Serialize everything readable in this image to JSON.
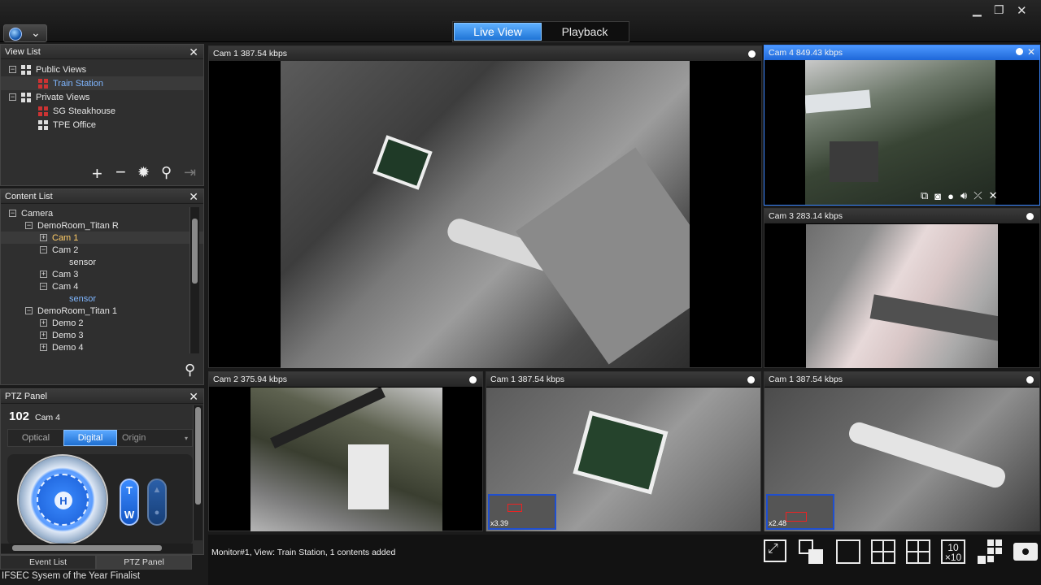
{
  "header": {
    "tabs": [
      {
        "label": "Live View",
        "active": true
      },
      {
        "label": "Playback",
        "active": false
      }
    ],
    "window_controls": [
      "minimize",
      "restore",
      "close"
    ]
  },
  "view_list": {
    "title": "View List",
    "items": [
      {
        "label": "Public Views",
        "level": 0
      },
      {
        "label": "Train Station",
        "level": 1,
        "highlighted": true
      },
      {
        "label": "Private Views",
        "level": 0
      },
      {
        "label": "SG Steakhouse",
        "level": 1
      },
      {
        "label": "TPE Office",
        "level": 1
      }
    ],
    "tools": [
      "add-icon",
      "remove-icon",
      "gear-icon",
      "search-icon",
      "export-icon"
    ]
  },
  "content_list": {
    "title": "Content List",
    "items": [
      {
        "label": "Camera",
        "level": 0
      },
      {
        "label": "DemoRoom_Titan R",
        "level": 1
      },
      {
        "label": "Cam 1",
        "level": 2,
        "highlighted": true
      },
      {
        "label": "Cam 2",
        "level": 2
      },
      {
        "label": "sensor",
        "level": 3
      },
      {
        "label": "Cam 3",
        "level": 2
      },
      {
        "label": "Cam 4",
        "level": 2
      },
      {
        "label": "sensor",
        "level": 3,
        "highlighted": true
      },
      {
        "label": "DemoRoom_Titan 1",
        "level": 1
      },
      {
        "label": "Demo 2",
        "level": 2
      },
      {
        "label": "Demo 3",
        "level": 2
      },
      {
        "label": "Demo 4",
        "level": 2
      }
    ]
  },
  "ptz": {
    "title": "PTZ Panel",
    "number": "102",
    "camera": "Cam 4",
    "modes": [
      "Optical",
      "Digital"
    ],
    "active_mode": "Digital",
    "origin_label": "Origin",
    "joystick_center": "H",
    "zoom_t": "T",
    "zoom_w": "W"
  },
  "bottom_tabs": [
    {
      "label": "Event List",
      "active": false
    },
    {
      "label": "PTZ Panel",
      "active": true
    }
  ],
  "footer_caption": "IFSEC Sysem of the Year Finalist",
  "cameras": [
    {
      "id": "main",
      "label": "Cam 1  387.54 kbps"
    },
    {
      "id": "top-right",
      "label": "Cam 4  849.43 kbps",
      "active": true
    },
    {
      "id": "mid-right",
      "label": "Cam 3  283.14 kbps"
    },
    {
      "id": "bottom-left",
      "label": "Cam 2  375.94 kbps"
    },
    {
      "id": "bottom-mid",
      "label": "Cam 1  387.54 kbps",
      "zoom": "x3.39"
    },
    {
      "id": "bottom-right",
      "label": "Cam 1  387.54 kbps",
      "zoom": "x2.48"
    }
  ],
  "status": {
    "message": "Monitor#1, View: Train Station, 1 contents added"
  },
  "layout_buttons": [
    "fullscreen-icon",
    "swap-icon",
    "layout-1x1-icon",
    "layout-2x2-icon",
    "layout-3x3-icon",
    "layout-10x10-icon",
    "layout-custom-icon",
    "snapshot-icon"
  ],
  "colors": {
    "accent": "#2a7de1",
    "highlight_text": "#7fb6ff"
  }
}
